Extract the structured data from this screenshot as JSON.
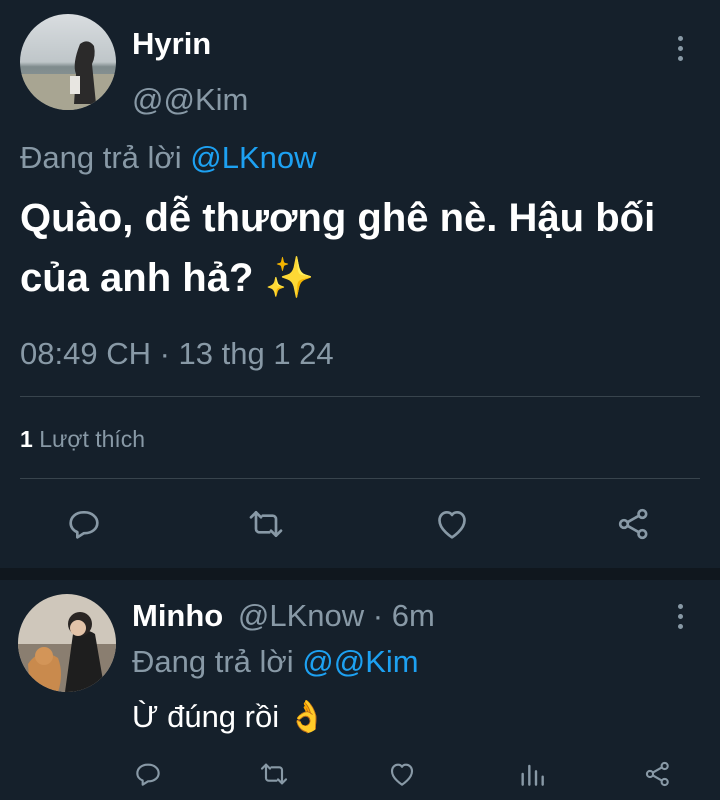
{
  "main_tweet": {
    "author_name": "Hyrin",
    "author_handle": "@@Kim",
    "replying_prefix": "Đang trả lời",
    "replying_to": "@LKnow",
    "text_line1": "Quào, dễ thương ghê nè. Hậu bối",
    "text_line2": "của anh hả?",
    "emoji": "✨",
    "timestamp": "08:49 CH · 13 thg 1 24",
    "likes_count": "1",
    "likes_label": "Lượt thích"
  },
  "reply_tweet": {
    "author_name": "Minho",
    "author_handle": "@LKnow",
    "time_ago": "· 6m",
    "replying_prefix": "Đang trả lời",
    "replying_to": "@@Kim",
    "text": "Ừ đúng rồi",
    "emoji": "👌"
  },
  "icons": {
    "reply": "reply-icon",
    "retweet": "retweet-icon",
    "like": "heart-icon",
    "share": "share-icon",
    "analytics": "analytics-icon",
    "more": "more-vertical-icon"
  },
  "colors": {
    "background": "#15202b",
    "accent": "#1da1f2",
    "muted": "#8899a6",
    "divider": "#38444d"
  }
}
